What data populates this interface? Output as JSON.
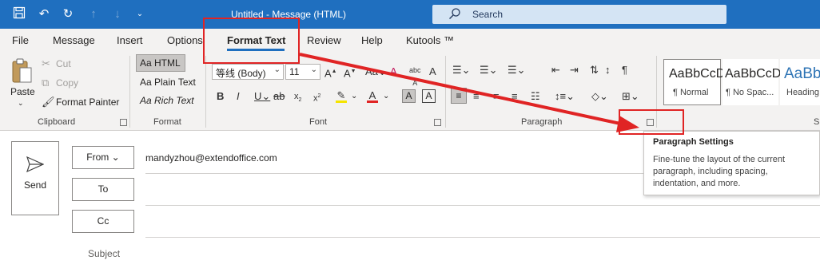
{
  "window": {
    "title": "Untitled  -  Message (HTML)"
  },
  "quick_access": {
    "save_icon": "save-icon",
    "undo_icon": "undo-icon",
    "redo_icon": "redo-icon",
    "up_icon": "arrow-up-icon",
    "down_icon": "arrow-down-icon",
    "customize_icon": "customize-icon"
  },
  "search": {
    "label": "Search"
  },
  "tabs": [
    {
      "label": "File"
    },
    {
      "label": "Message"
    },
    {
      "label": "Insert"
    },
    {
      "label": "Options"
    },
    {
      "label": "Format Text"
    },
    {
      "label": "Review"
    },
    {
      "label": "Help"
    },
    {
      "label": "Kutools ™"
    }
  ],
  "active_tab": "Format Text",
  "clipboard": {
    "paste": "Paste",
    "cut": "Cut",
    "copy": "Copy",
    "format_painter": "Format Painter",
    "group_label": "Clipboard"
  },
  "format": {
    "html": "Aa HTML",
    "plain": "Aa Plain Text",
    "rich": "Aa Rich Text",
    "group_label": "Format"
  },
  "font": {
    "name": "等线 (Body)",
    "size": "11",
    "group_label": "Font",
    "highlight_color": "#f5e400",
    "font_color": "#e02424"
  },
  "paragraph": {
    "group_label": "Paragraph"
  },
  "styles": [
    {
      "sample": "AaBbCcD",
      "name": "¶ Normal"
    },
    {
      "sample": "AaBbCcD",
      "name": "¶ No Spac..."
    },
    {
      "sample": "AaBb",
      "name": "Heading"
    }
  ],
  "styles_group_partial": "S",
  "compose": {
    "send": "Send",
    "from_label": "From",
    "from_value": "mandyzhou@extendoffice.com",
    "to_label": "To",
    "cc_label": "Cc",
    "subject_label": "Subject"
  },
  "tooltip": {
    "title": "Paragraph Settings",
    "body": "Fine-tune the layout of the current paragraph, including spacing, indentation, and more."
  },
  "annotation_color": "#e02424"
}
